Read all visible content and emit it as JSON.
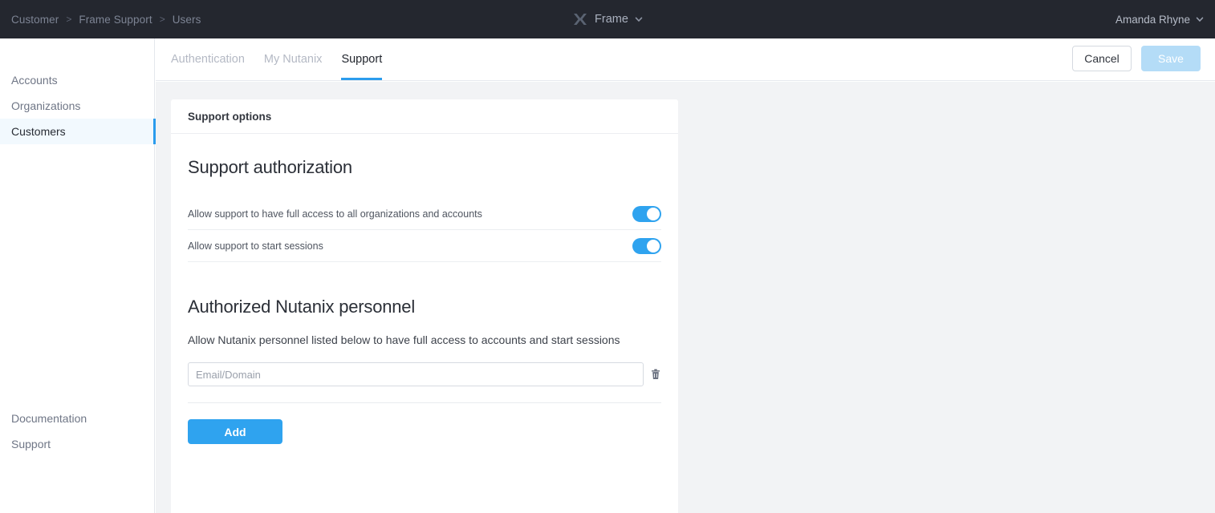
{
  "topbar": {
    "breadcrumb": [
      {
        "label": "Customer"
      },
      {
        "label": "Frame Support"
      },
      {
        "label": "Users"
      }
    ],
    "separator": ">",
    "brand_name": "Frame",
    "brand_icon": "frame-x-logo",
    "brand_caret_icon": "chevron-down-icon",
    "user_name": "Amanda Rhyne",
    "user_caret_icon": "chevron-down-icon",
    "background_color": "#24272f"
  },
  "sidebar": {
    "top_items": [
      {
        "label": "Accounts",
        "active": false
      },
      {
        "label": "Organizations",
        "active": false
      },
      {
        "label": "Customers",
        "active": true
      }
    ],
    "bottom_items": [
      {
        "label": "Documentation"
      },
      {
        "label": "Support"
      }
    ],
    "active_accent_color": "#2b9ced",
    "active_background_color": "#f2f9fe"
  },
  "tabbar": {
    "tabs": [
      {
        "label": "Authentication",
        "active": false
      },
      {
        "label": "My Nutanix",
        "active": false
      },
      {
        "label": "Support",
        "active": true
      }
    ],
    "active_underline_color": "#2b9ced",
    "cancel_label": "Cancel",
    "save_label": "Save",
    "save_disabled_color": "#b4dcf7"
  },
  "card": {
    "header": "Support options",
    "support_authorization": {
      "title": "Support authorization",
      "toggles": [
        {
          "label": "Allow support to have full access to all organizations and accounts",
          "on": true
        },
        {
          "label": "Allow support to start sessions",
          "on": true
        }
      ],
      "toggle_on_color": "#2fa3ef"
    },
    "authorized_personnel": {
      "title": "Authorized Nutanix personnel",
      "description": "Allow Nutanix personnel listed below to have full access to accounts and start sessions",
      "entry_value": "",
      "entry_placeholder": "Email/Domain",
      "delete_icon": "trash-icon",
      "add_label": "Add",
      "add_color": "#2fa3ef"
    }
  },
  "page_background_color": "#f2f3f5"
}
